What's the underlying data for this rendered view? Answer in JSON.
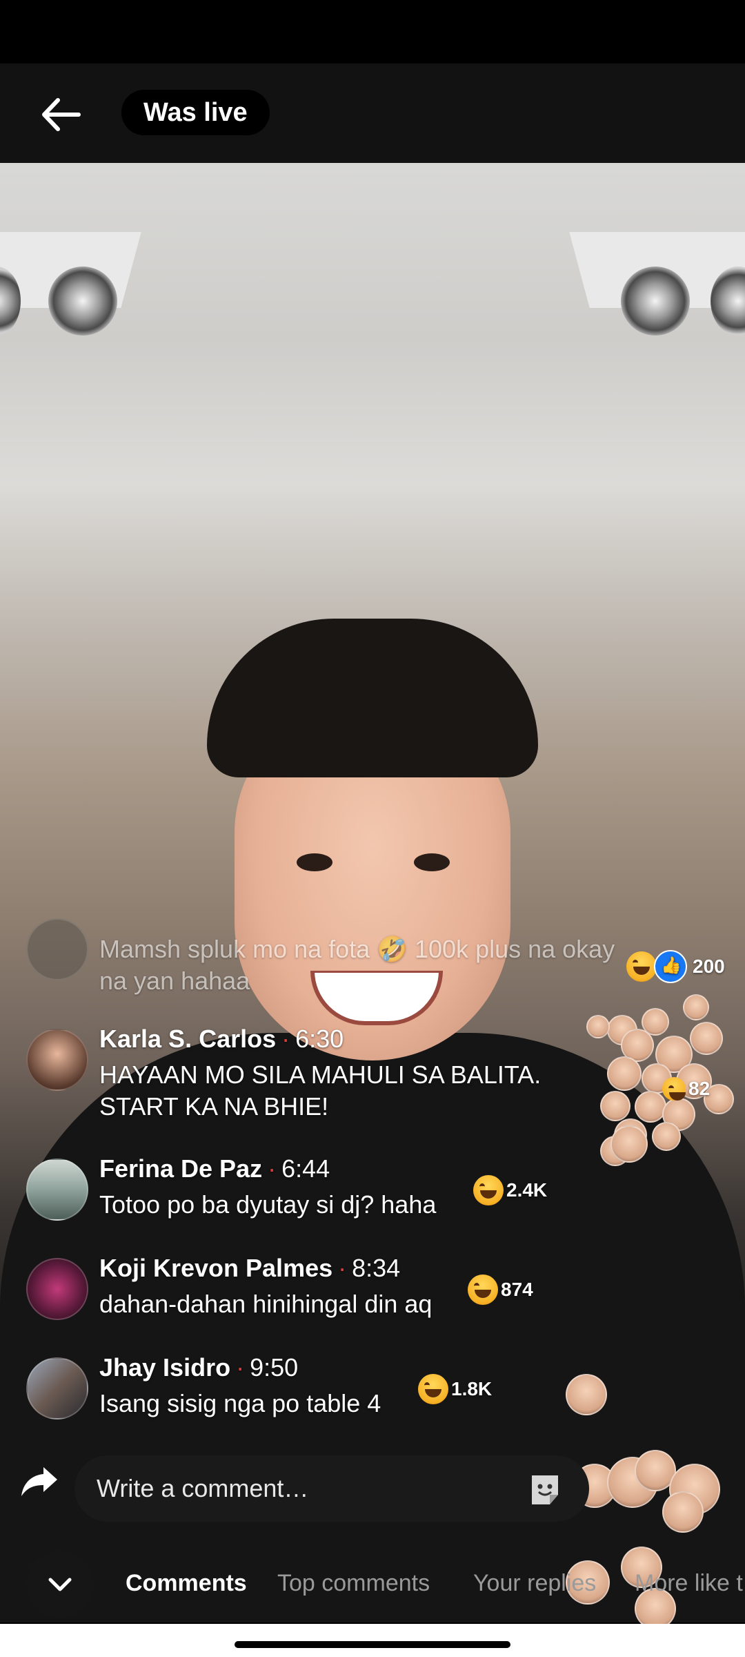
{
  "header": {
    "title": "Was live"
  },
  "comments": [
    {
      "name": "",
      "time": "",
      "text": "Mamsh spluk mo na fota 🤣 100k plus na okay na yan hahaa",
      "reaction_count": "200"
    },
    {
      "name": "Karla S. Carlos",
      "time": "6:30",
      "text": "HAYAAN MO SILA MAHULI SA BALITA. START KA NA BHIE!",
      "reaction_count": "82"
    },
    {
      "name": "Ferina De Paz",
      "time": "6:44",
      "text": "Totoo po ba dyutay si dj? haha",
      "reaction_count": "2.4K"
    },
    {
      "name": "Koji Krevon Palmes",
      "time": "8:34",
      "text": "dahan-dahan hinihingal din aq",
      "reaction_count": "874"
    },
    {
      "name": "Jhay Isidro",
      "time": "9:50",
      "text": "Isang sisig nga po table 4",
      "reaction_count": "1.8K"
    }
  ],
  "composer": {
    "placeholder": "Write a comment…"
  },
  "tabs": [
    {
      "label": "Comments",
      "active": true
    },
    {
      "label": "Top comments",
      "active": false
    },
    {
      "label": "Your replies",
      "active": false
    },
    {
      "label": "More like t",
      "active": false
    }
  ],
  "icons": {
    "back": "back-arrow-icon",
    "share": "share-arrow-icon",
    "sticker": "sticker-icon",
    "collapse": "chevron-down-icon",
    "reaction_haha": "haha-reaction-icon",
    "reaction_like": "like-reaction-icon"
  },
  "colors": {
    "accent_like": "#1877f2",
    "dot_separator": "#e43a3a"
  }
}
